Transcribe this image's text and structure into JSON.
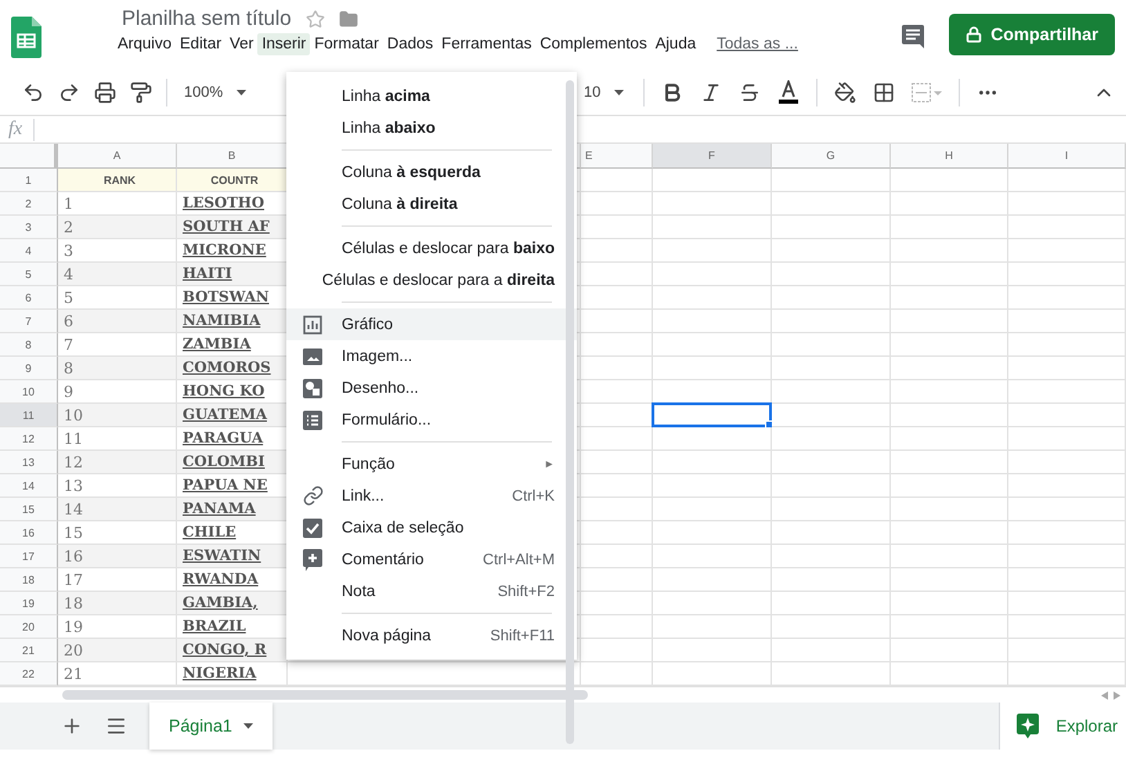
{
  "app": {
    "title": "Planilha sem título",
    "all_changes_link": "Todas as ...",
    "share_button": "Compartilhar",
    "menus": [
      {
        "label": "Arquivo",
        "selected": false
      },
      {
        "label": "Editar",
        "selected": false
      },
      {
        "label": "Ver",
        "selected": false
      },
      {
        "label": "Inserir",
        "selected": true
      },
      {
        "label": "Formatar",
        "selected": false
      },
      {
        "label": "Dados",
        "selected": false
      },
      {
        "label": "Ferramentas",
        "selected": false
      },
      {
        "label": "Complementos",
        "selected": false
      },
      {
        "label": "Ajuda",
        "selected": false
      }
    ]
  },
  "toolbar": {
    "zoom": "100%",
    "font_size": "10"
  },
  "formula_bar": {
    "label": "fx"
  },
  "grid": {
    "columns": [
      {
        "label": "A",
        "selected": false
      },
      {
        "label": "B",
        "selected": false
      },
      {
        "label": "E",
        "selected": false
      },
      {
        "label": "F",
        "selected": true
      },
      {
        "label": "G",
        "selected": false
      },
      {
        "label": "H",
        "selected": false
      },
      {
        "label": "I",
        "selected": false
      }
    ],
    "rows": [
      {
        "number": "1",
        "kind": "header",
        "selected": false,
        "cells": [
          "RANK",
          "COUNTR"
        ]
      },
      {
        "number": "2",
        "kind": "data",
        "selected": false,
        "cells": [
          "1",
          "LESOTHO"
        ]
      },
      {
        "number": "3",
        "kind": "data",
        "selected": false,
        "cells": [
          "2",
          "SOUTH AF"
        ]
      },
      {
        "number": "4",
        "kind": "data",
        "selected": false,
        "cells": [
          "3",
          "MICRONE"
        ]
      },
      {
        "number": "5",
        "kind": "data",
        "selected": false,
        "cells": [
          "4",
          "HAITI"
        ]
      },
      {
        "number": "6",
        "kind": "data",
        "selected": false,
        "cells": [
          "5",
          "BOTSWAN"
        ]
      },
      {
        "number": "7",
        "kind": "data",
        "selected": false,
        "cells": [
          "6",
          "NAMIBIA"
        ]
      },
      {
        "number": "8",
        "kind": "data",
        "selected": false,
        "cells": [
          "7",
          "ZAMBIA"
        ]
      },
      {
        "number": "9",
        "kind": "data",
        "selected": false,
        "cells": [
          "8",
          "COMOROS"
        ]
      },
      {
        "number": "10",
        "kind": "data",
        "selected": false,
        "cells": [
          "9",
          "HONG KO"
        ]
      },
      {
        "number": "11",
        "kind": "data",
        "selected": true,
        "cells": [
          "10",
          "GUATEMA"
        ]
      },
      {
        "number": "12",
        "kind": "data",
        "selected": false,
        "cells": [
          "11",
          "PARAGUA"
        ]
      },
      {
        "number": "13",
        "kind": "data",
        "selected": false,
        "cells": [
          "12",
          "COLOMBI"
        ]
      },
      {
        "number": "14",
        "kind": "data",
        "selected": false,
        "cells": [
          "13",
          "PAPUA NE"
        ]
      },
      {
        "number": "15",
        "kind": "data",
        "selected": false,
        "cells": [
          "14",
          "PANAMA"
        ]
      },
      {
        "number": "16",
        "kind": "data",
        "selected": false,
        "cells": [
          "15",
          "CHILE"
        ]
      },
      {
        "number": "17",
        "kind": "data",
        "selected": false,
        "cells": [
          "16",
          "ESWATIN"
        ]
      },
      {
        "number": "18",
        "kind": "data",
        "selected": false,
        "cells": [
          "17",
          "RWANDA"
        ]
      },
      {
        "number": "19",
        "kind": "data",
        "selected": false,
        "cells": [
          "18",
          "GAMBIA,"
        ]
      },
      {
        "number": "20",
        "kind": "data",
        "selected": false,
        "cells": [
          "19",
          "BRAZIL"
        ]
      },
      {
        "number": "21",
        "kind": "data",
        "selected": false,
        "cells": [
          "20",
          "CONGO, R"
        ]
      },
      {
        "number": "22",
        "kind": "data",
        "selected": false,
        "cells": [
          "21",
          "NIGERIA"
        ]
      }
    ]
  },
  "insert_menu": {
    "items": [
      {
        "kind": "item",
        "label": "Linha **acima**",
        "selected": false
      },
      {
        "kind": "item",
        "label": "Linha **abaixo**",
        "selected": false
      },
      {
        "kind": "separator"
      },
      {
        "kind": "item",
        "label": "Coluna **à esquerda**",
        "selected": false
      },
      {
        "kind": "item",
        "label": "Coluna **à direita**",
        "selected": false
      },
      {
        "kind": "separator"
      },
      {
        "kind": "item",
        "label": "Células e deslocar para **baixo**",
        "selected": false
      },
      {
        "kind": "item",
        "label": "Células e deslocar para a **direita**",
        "selected": false
      },
      {
        "kind": "separator"
      },
      {
        "kind": "chart",
        "label": "Gráfico",
        "selected": true
      },
      {
        "kind": "image",
        "label": "Imagem...",
        "selected": false
      },
      {
        "kind": "drawing",
        "label": "Desenho...",
        "selected": false
      },
      {
        "kind": "form",
        "label": "Formulário...",
        "selected": false
      },
      {
        "kind": "separator"
      },
      {
        "kind": "item",
        "label": "Função",
        "arrow": "►",
        "selected": false
      },
      {
        "kind": "link",
        "label": "Link...",
        "shortcut": "Ctrl+K",
        "selected": false
      },
      {
        "kind": "checkbox",
        "label": "Caixa de seleção",
        "selected": false
      },
      {
        "kind": "comment",
        "label": "Comentário",
        "shortcut": "Ctrl+Alt+M",
        "selected": false
      },
      {
        "kind": "item",
        "label": "Nota",
        "shortcut": "Shift+F2",
        "selected": false
      },
      {
        "kind": "separator"
      },
      {
        "kind": "item",
        "label": "Nova página",
        "shortcut": "Shift+F11",
        "selected": false
      }
    ]
  },
  "sheet_bar": {
    "tabs": [
      {
        "label": "Página1",
        "selected": true
      }
    ],
    "explore_button": "Explorar"
  }
}
